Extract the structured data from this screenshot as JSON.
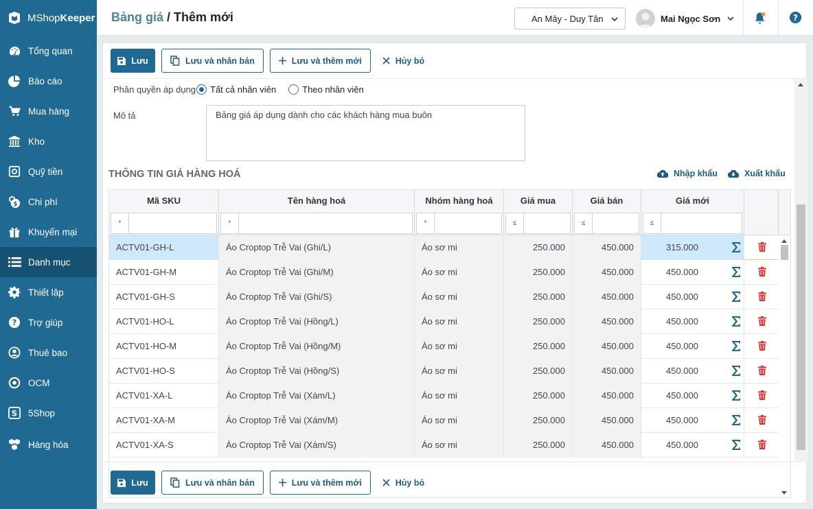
{
  "app": {
    "name_part1": "MShop",
    "name_part2": "Keeper"
  },
  "sidebar": {
    "items": [
      {
        "label": "Tổng quan",
        "icon": "dashboard-icon"
      },
      {
        "label": "Báo cáo",
        "icon": "pie-chart-icon"
      },
      {
        "label": "Mua hàng",
        "icon": "cart-icon"
      },
      {
        "label": "Kho",
        "icon": "warehouse-icon"
      },
      {
        "label": "Quỹ tiền",
        "icon": "safe-icon"
      },
      {
        "label": "Chi phí",
        "icon": "money-icon"
      },
      {
        "label": "Khuyến mại",
        "icon": "gift-icon"
      },
      {
        "label": "Danh mục",
        "icon": "list-icon",
        "active": true
      },
      {
        "label": "Thiết lập",
        "icon": "gear-icon"
      },
      {
        "label": "Trợ giúp",
        "icon": "help-icon"
      },
      {
        "label": "Thuê bao",
        "icon": "user-icon"
      },
      {
        "label": "OCM",
        "icon": "ocm-icon"
      },
      {
        "label": "5Shop",
        "icon": "fiveshop-icon"
      },
      {
        "label": "Hàng hóa",
        "icon": "boxes-icon"
      }
    ]
  },
  "header": {
    "breadcrumb": "Bảng giá",
    "separator": " / ",
    "title": "Thêm mới",
    "store": "An Mây - Duy Tân",
    "user": "Mai Ngọc Sơn"
  },
  "toolbar": {
    "save": "Lưu",
    "save_copy": "Lưu và nhân bản",
    "save_new": "Lưu và thêm mới",
    "cancel": "Hủy bỏ"
  },
  "form": {
    "perm_label": "Phân quyền áp dụng",
    "perm_all": "Tất cả nhân viên",
    "perm_by": "Theo nhân viên",
    "desc_label": "Mô tả",
    "desc_value": "Bảng giá áp dụng dành cho các khách hàng mua buôn"
  },
  "section": {
    "title": "THÔNG TIN GIÁ HÀNG HOÁ",
    "import": "Nhập khẩu",
    "export": "Xuất khẩu"
  },
  "table": {
    "headers": [
      "Mã SKU",
      "Tên hàng hoá",
      "Nhóm hàng hoá",
      "Giá mua",
      "Giá bán",
      "Giá mới"
    ],
    "filter_ops": [
      "*",
      "*",
      "*",
      "≤",
      "≤",
      "≤"
    ],
    "rows": [
      [
        "ACTV01-GH-L",
        "Áo Croptop Trễ Vai (Ghi/L)",
        "Áo sơ mi",
        "250.000",
        "450.000",
        "315.000"
      ],
      [
        "ACTV01-GH-M",
        "Áo Croptop Trễ Vai (Ghi/M)",
        "Áo sơ mi",
        "250.000",
        "450.000",
        "450.000"
      ],
      [
        "ACTV01-GH-S",
        "Áo Croptop Trễ Vai (Ghi/S)",
        "Áo sơ mi",
        "250.000",
        "450.000",
        "450.000"
      ],
      [
        "ACTV01-HO-L",
        "Áo Croptop Trễ Vai (Hồng/L)",
        "Áo sơ mi",
        "250.000",
        "450.000",
        "450.000"
      ],
      [
        "ACTV01-HO-M",
        "Áo Croptop Trễ Vai (Hồng/M)",
        "Áo sơ mi",
        "250.000",
        "450.000",
        "450.000"
      ],
      [
        "ACTV01-HO-S",
        "Áo Croptop Trễ Vai (Hồng/S)",
        "Áo sơ mi",
        "250.000",
        "450.000",
        "450.000"
      ],
      [
        "ACTV01-XA-L",
        "Áo Croptop Trễ Vai (Xám/L)",
        "Áo sơ mi",
        "250.000",
        "450.000",
        "450.000"
      ],
      [
        "ACTV01-XA-M",
        "Áo Croptop Trễ Vai (Xám/M)",
        "Áo sơ mi",
        "250.000",
        "450.000",
        "450.000"
      ],
      [
        "ACTV01-XA-S",
        "Áo Croptop Trễ Vai (Xám/S)",
        "Áo sơ mi",
        "250.000",
        "450.000",
        "450.000"
      ]
    ]
  },
  "colors": {
    "primary": "#1f6993",
    "sidebar_active": "#165172",
    "delete": "#e03434",
    "selected_row": "#cfe8fb"
  }
}
